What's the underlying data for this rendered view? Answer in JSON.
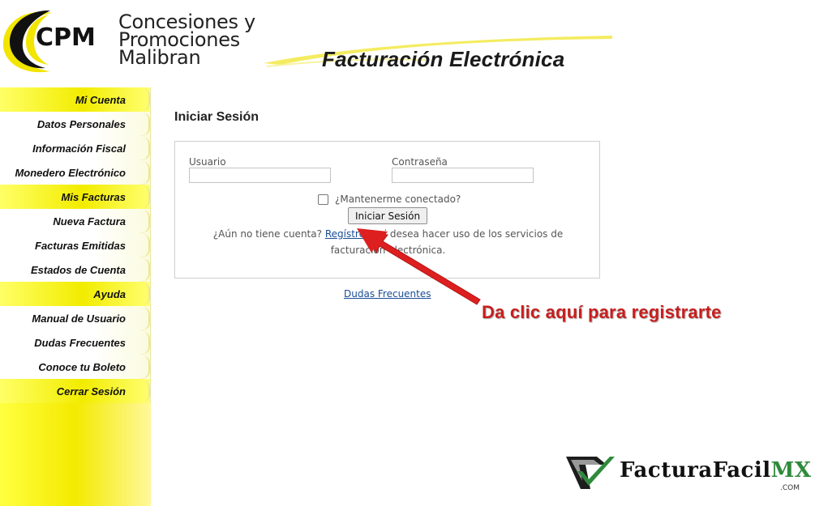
{
  "header": {
    "logo_text": "CPM",
    "company_name": [
      "Concesiones y",
      "Promociones",
      "Malibran"
    ],
    "title": "Facturación Electrónica"
  },
  "sidebar": {
    "items": [
      {
        "label": "Mi Cuenta",
        "kind": "section"
      },
      {
        "label": "Datos Personales",
        "kind": "link"
      },
      {
        "label": "Información Fiscal",
        "kind": "link"
      },
      {
        "label": "Monedero Electrónico",
        "kind": "link"
      },
      {
        "label": "Mis Facturas",
        "kind": "section"
      },
      {
        "label": "Nueva Factura",
        "kind": "link"
      },
      {
        "label": "Facturas Emitidas",
        "kind": "link"
      },
      {
        "label": "Estados de Cuenta",
        "kind": "link"
      },
      {
        "label": "Ayuda",
        "kind": "section"
      },
      {
        "label": "Manual de Usuario",
        "kind": "link"
      },
      {
        "label": "Dudas Frecuentes",
        "kind": "link"
      },
      {
        "label": "Conoce tu Boleto",
        "kind": "link"
      },
      {
        "label": "Cerrar Sesión",
        "kind": "section"
      }
    ]
  },
  "login": {
    "title": "Iniciar Sesión",
    "user_label": "Usuario",
    "user_value": "",
    "password_label": "Contraseña",
    "password_value": "",
    "keep_connected_label": "¿Mantenerme conectado?",
    "keep_connected_checked": false,
    "submit_label": "Iniciar Sesión",
    "register_prefix": "¿Aún no tiene cuenta?",
    "register_link": "Regístrese",
    "register_suffix": "si desea hacer uso de los servicios de facturación electrónica."
  },
  "faq_link": "Dudas Frecuentes",
  "annotation": {
    "text": "Da clic aquí para registrarte",
    "color": "#c81e1e"
  },
  "watermark": {
    "brand": "FacturaFacil",
    "brand_suffix": "MX",
    "domain": ".COM"
  },
  "colors": {
    "sidebar_yellow": "#f2ec00",
    "link_blue": "#1a4d96",
    "accent_green": "#2f8a3c"
  }
}
